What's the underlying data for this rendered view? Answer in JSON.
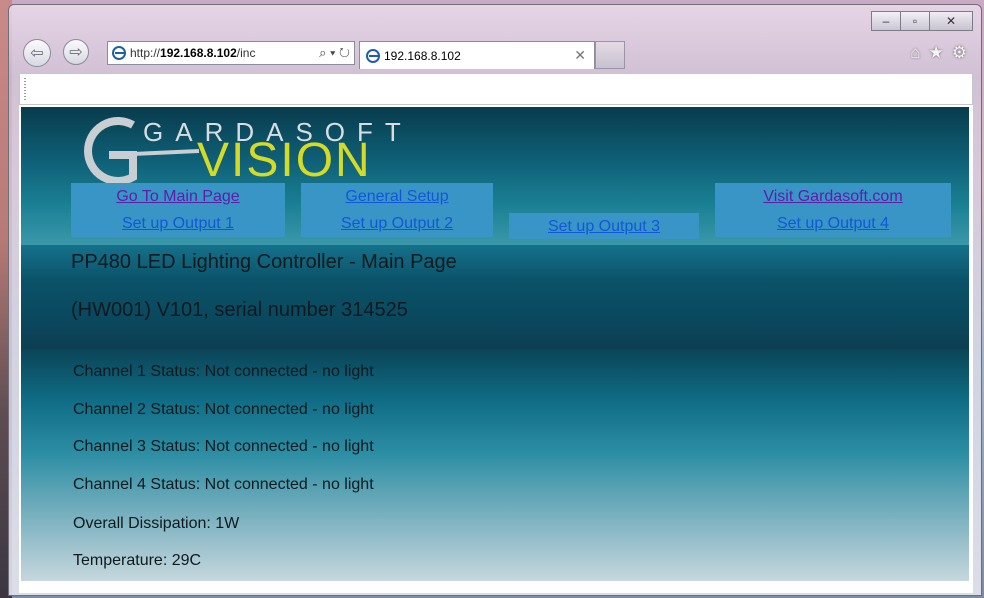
{
  "browser": {
    "url_prefix": "http://",
    "url_host": "192.168.8.102",
    "url_suffix": "/inc",
    "address_tools": "⌕ ▾ ↻",
    "tab_title": "192.168.8.102",
    "tab_close": "✕",
    "window_controls": {
      "minimize": "–",
      "maximize": "▫",
      "close": "✕"
    },
    "right_icons": {
      "home": "⌂",
      "favorites": "★",
      "tools": "⚙"
    }
  },
  "logo": {
    "top_text": "GARDASOFT",
    "bottom_text": "VISION",
    "colors": {
      "top": "#d9dde0",
      "bottom": "#d4da26"
    }
  },
  "nav": {
    "main_page": "Go To Main Page",
    "general_setup": "General Setup",
    "visit": "Visit Gardasoft.com",
    "output1": "Set up Output 1",
    "output2": "Set up Output 2",
    "output3": "Set up Output 3",
    "output4": "Set up Output 4"
  },
  "page": {
    "title": "PP480 LED Lighting Controller - Main Page",
    "subtitle": "(HW001) V101, serial number 314525"
  },
  "status": {
    "ch1": "Channel 1 Status: Not connected - no light",
    "ch2": "Channel 2 Status: Not connected - no light",
    "ch3": "Channel 3 Status: Not connected - no light",
    "ch4": "Channel 4 Status: Not connected - no light",
    "dissipation": "Overall Dissipation: 1W",
    "temperature": "Temperature: 29C"
  },
  "colors": {
    "nav_cell": "#3a95c7",
    "link": "#1158d6",
    "visited_link": "#5b1ea8"
  }
}
